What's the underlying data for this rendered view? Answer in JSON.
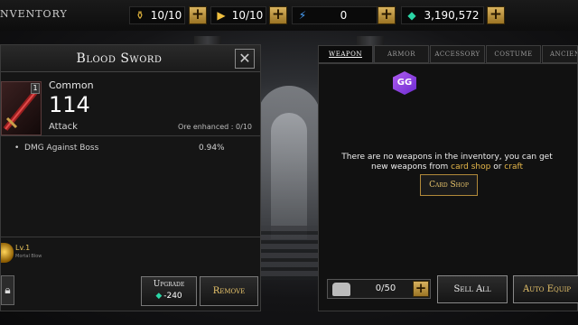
{
  "header": {
    "title": "NVENTORY",
    "resources": [
      {
        "icon": "stamina-potion-icon",
        "value": "10/10"
      },
      {
        "icon": "ticket-icon",
        "value": "10/10"
      },
      {
        "icon": "crystal-icon",
        "value": "0"
      },
      {
        "icon": "gem-icon",
        "value": "3,190,572"
      }
    ]
  },
  "item_panel": {
    "title": "Blood Sword",
    "icon": "blood-sword-icon",
    "level_badge": "1",
    "rarity": "Common",
    "power": "114",
    "stat_label": "Attack",
    "ore_enhanced": "Ore enhanced : 0/10",
    "option": {
      "name": "DMG Against Boss",
      "value": "0.94%"
    },
    "skill": {
      "level": "Lv.1",
      "name": "Mortal Blow"
    },
    "upgrade": {
      "label": "Upgrade",
      "cost": "-240"
    },
    "remove_label": "Remove"
  },
  "inventory_panel": {
    "tabs": [
      "Weapon",
      "Armor",
      "Accessory",
      "Costume",
      "Ancient"
    ],
    "active_tab": "Weapon",
    "empty_message": {
      "part1": "There are no weapons in the inventory, you can get new weapons from ",
      "link1": "card shop",
      "part2": " or ",
      "link2": "craft"
    },
    "card_shop_label": "Card Shop",
    "capacity": "0/50",
    "sell_all_label": "Sell All",
    "auto_equip_label": "Auto Equip"
  },
  "colors": {
    "accent_gold": "#e9c56b",
    "gem": "#2bd6a6",
    "overlay_badge": "#8a3ce0"
  }
}
